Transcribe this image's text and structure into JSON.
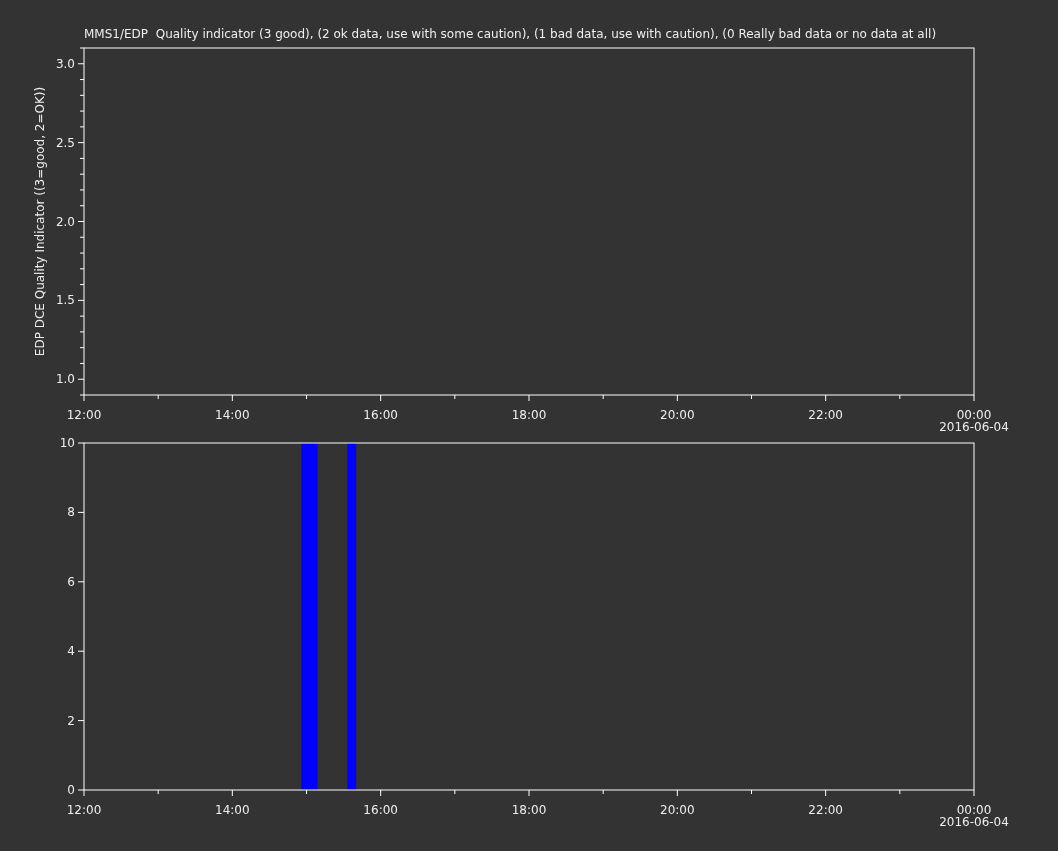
{
  "panels": [
    {
      "x_date_label": "2016-06-04",
      "x_minor_ticks": true,
      "y_minor_ticks": true,
      "chart_data": {
        "type": "line",
        "title": "MMS1/EDP  Quality indicator (3 good), (2 ok data, use with some caution), (1 bad data, use with caution), (0 Really bad data or no data at all)",
        "ylabel": "EDP DCE Quality Indicator ((3=good, 2=OK))",
        "xlim": [
          12,
          24
        ],
        "ylim": [
          0.9,
          3.1
        ],
        "xticks": [
          {
            "value": 12,
            "label": "12:00"
          },
          {
            "value": 14,
            "label": "14:00"
          },
          {
            "value": 16,
            "label": "16:00"
          },
          {
            "value": 18,
            "label": "18:00"
          },
          {
            "value": 20,
            "label": "20:00"
          },
          {
            "value": 22,
            "label": "22:00"
          },
          {
            "value": 24,
            "label": "00:00"
          }
        ],
        "yticks": [
          {
            "value": 1,
            "label": "1.0"
          },
          {
            "value": 1.5,
            "label": "1.5"
          },
          {
            "value": 2,
            "label": "2.0"
          },
          {
            "value": 2.5,
            "label": "2.5"
          },
          {
            "value": 3,
            "label": "3.0"
          }
        ]
      }
    },
    {
      "x_date_label": "2016-06-04",
      "x_minor_ticks": true,
      "y_minor_ticks": false,
      "chart_data": {
        "type": "area",
        "xlim": [
          12,
          24
        ],
        "ylim": [
          0,
          10
        ],
        "xticks": [
          {
            "value": 12,
            "label": "12:00"
          },
          {
            "value": 14,
            "label": "14:00"
          },
          {
            "value": 16,
            "label": "16:00"
          },
          {
            "value": 18,
            "label": "18:00"
          },
          {
            "value": 20,
            "label": "20:00"
          },
          {
            "value": 22,
            "label": "22:00"
          },
          {
            "value": 24,
            "label": "00:00"
          }
        ],
        "yticks": [
          0,
          2,
          4,
          6,
          8,
          10
        ],
        "series": [
          {
            "color": "#0000ff",
            "x": [
              14.93,
              14.93,
              15.15,
              15.15,
              15.55,
              15.55,
              15.67,
              15.67
            ],
            "values": [
              0,
              10,
              10,
              0,
              0,
              10,
              10,
              0
            ]
          }
        ]
      }
    }
  ]
}
